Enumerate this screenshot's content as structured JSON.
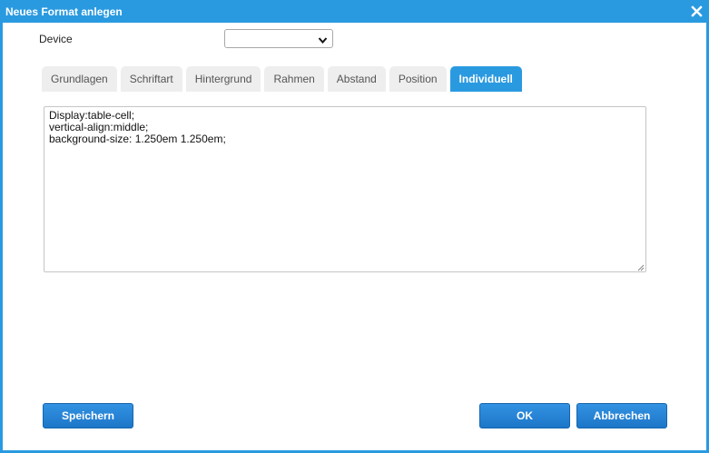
{
  "dialog": {
    "title": "Neues Format anlegen"
  },
  "device": {
    "label": "Device",
    "selected": ""
  },
  "tabs": [
    {
      "label": "Grundlagen",
      "active": false
    },
    {
      "label": "Schriftart",
      "active": false
    },
    {
      "label": "Hintergrund",
      "active": false
    },
    {
      "label": "Rahmen",
      "active": false
    },
    {
      "label": "Abstand",
      "active": false
    },
    {
      "label": "Position",
      "active": false
    },
    {
      "label": "Individuell",
      "active": true
    }
  ],
  "custom_css": {
    "lines": [
      "Display:table-cell;",
      "vertical-align:middle;",
      "background-size: 1.250em 1.250em;"
    ]
  },
  "buttons": {
    "save": "Speichern",
    "ok": "OK",
    "cancel": "Abbrechen"
  },
  "colors": {
    "accent": "#2a9ae0",
    "button": "#1d76c8",
    "tab_inactive": "#eeeeee"
  },
  "icons": {
    "close": "close-icon",
    "dropdown": "chevron-down-icon",
    "resize": "resize-grip-icon"
  }
}
